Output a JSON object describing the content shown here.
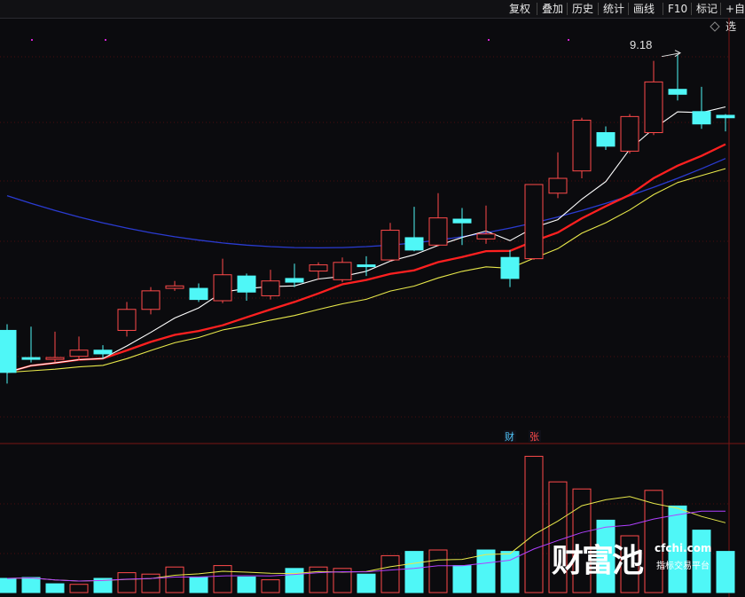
{
  "toolbar": {
    "buttons": [
      "复权",
      "叠加",
      "历史",
      "统计",
      "画线",
      "F10",
      "标记",
      "+自选"
    ]
  },
  "chart_data": {
    "type": "candlestick",
    "annotation": {
      "label": "9.18"
    },
    "flags": [
      {
        "label": "财",
        "color": "#4fc3f7"
      },
      {
        "label": "张",
        "color": "#ff4a4a"
      }
    ],
    "colors": {
      "up": "#ff4a4a",
      "down": "#4ff7f7",
      "ma5": "#ffffff",
      "ma10": "#ff2020",
      "ma20": "#e8e84a",
      "ma60": "#2a3bd0",
      "vol_ma5": "#e8e84a",
      "vol_ma10": "#b040ff"
    },
    "candles": [
      {
        "o": 6.95,
        "c": 6.61,
        "h": 7.0,
        "l": 6.52
      },
      {
        "o": 6.73,
        "c": 6.72,
        "h": 6.98,
        "l": 6.69
      },
      {
        "o": 6.72,
        "c": 6.73,
        "h": 6.94,
        "l": 6.69
      },
      {
        "o": 6.74,
        "c": 6.79,
        "h": 6.9,
        "l": 6.71
      },
      {
        "o": 6.79,
        "c": 6.76,
        "h": 6.83,
        "l": 6.72
      },
      {
        "o": 6.95,
        "c": 7.12,
        "h": 7.18,
        "l": 6.9
      },
      {
        "o": 7.12,
        "c": 7.27,
        "h": 7.3,
        "l": 7.08
      },
      {
        "o": 7.29,
        "c": 7.31,
        "h": 7.35,
        "l": 7.27
      },
      {
        "o": 7.29,
        "c": 7.2,
        "h": 7.33,
        "l": 7.18
      },
      {
        "o": 7.19,
        "c": 7.4,
        "h": 7.53,
        "l": 7.17
      },
      {
        "o": 7.39,
        "c": 7.26,
        "h": 7.41,
        "l": 7.19
      },
      {
        "o": 7.23,
        "c": 7.35,
        "h": 7.44,
        "l": 7.2
      },
      {
        "o": 7.37,
        "c": 7.34,
        "h": 7.49,
        "l": 7.3
      },
      {
        "o": 7.43,
        "c": 7.48,
        "h": 7.5,
        "l": 7.36
      },
      {
        "o": 7.36,
        "c": 7.5,
        "h": 7.54,
        "l": 7.34
      },
      {
        "o": 7.48,
        "c": 7.47,
        "h": 7.55,
        "l": 7.39
      },
      {
        "o": 7.52,
        "c": 7.76,
        "h": 7.82,
        "l": 7.51
      },
      {
        "o": 7.7,
        "c": 7.6,
        "h": 7.95,
        "l": 7.59
      },
      {
        "o": 7.64,
        "c": 7.86,
        "h": 8.06,
        "l": 7.63
      },
      {
        "o": 7.85,
        "c": 7.82,
        "h": 7.94,
        "l": 7.64
      },
      {
        "o": 7.69,
        "c": 7.73,
        "h": 7.96,
        "l": 7.65
      },
      {
        "o": 7.54,
        "c": 7.37,
        "h": 7.6,
        "l": 7.3
      },
      {
        "o": 7.53,
        "c": 8.13,
        "h": 8.13,
        "l": 7.52
      },
      {
        "o": 8.06,
        "c": 8.18,
        "h": 8.39,
        "l": 8.02
      },
      {
        "o": 8.24,
        "c": 8.65,
        "h": 8.67,
        "l": 8.18
      },
      {
        "o": 8.55,
        "c": 8.44,
        "h": 8.6,
        "l": 8.41
      },
      {
        "o": 8.4,
        "c": 8.68,
        "h": 8.7,
        "l": 8.38
      },
      {
        "o": 8.55,
        "c": 8.96,
        "h": 9.13,
        "l": 8.53
      },
      {
        "o": 8.9,
        "c": 8.86,
        "h": 9.18,
        "l": 8.81
      },
      {
        "o": 8.72,
        "c": 8.62,
        "h": 8.92,
        "l": 8.58
      },
      {
        "o": 8.69,
        "c": 8.67,
        "h": 8.7,
        "l": 8.56
      }
    ],
    "volume": [
      {
        "v": 5.0,
        "up": false
      },
      {
        "v": 5.3,
        "up": false
      },
      {
        "v": 3.1,
        "up": false
      },
      {
        "v": 2.9,
        "up": true
      },
      {
        "v": 5.0,
        "up": false
      },
      {
        "v": 7.0,
        "up": true
      },
      {
        "v": 6.5,
        "up": true
      },
      {
        "v": 9.0,
        "up": true
      },
      {
        "v": 5.5,
        "up": false
      },
      {
        "v": 9.5,
        "up": true
      },
      {
        "v": 5.5,
        "up": false
      },
      {
        "v": 4.5,
        "up": true
      },
      {
        "v": 8.5,
        "up": false
      },
      {
        "v": 9.0,
        "up": true
      },
      {
        "v": 8.5,
        "up": true
      },
      {
        "v": 6.5,
        "up": false
      },
      {
        "v": 13.0,
        "up": true
      },
      {
        "v": 14.5,
        "up": false
      },
      {
        "v": 15.0,
        "up": true
      },
      {
        "v": 9.5,
        "up": false
      },
      {
        "v": 15.0,
        "up": false
      },
      {
        "v": 14.5,
        "up": false
      },
      {
        "v": 48.0,
        "up": true
      },
      {
        "v": 39.0,
        "up": true
      },
      {
        "v": 36.5,
        "up": true
      },
      {
        "v": 25.5,
        "up": false
      },
      {
        "v": 20.0,
        "up": true
      },
      {
        "v": 36.0,
        "up": true
      },
      {
        "v": 30.5,
        "up": false
      },
      {
        "v": 22.0,
        "up": false
      },
      {
        "v": 14.5,
        "up": false
      }
    ],
    "ylim": [
      6.25,
      9.35
    ],
    "vol_ylim": [
      0,
      50
    ]
  },
  "watermark": {
    "brand": "财富池",
    "site": "cfchi.com",
    "tagline": "指标交易平台"
  }
}
